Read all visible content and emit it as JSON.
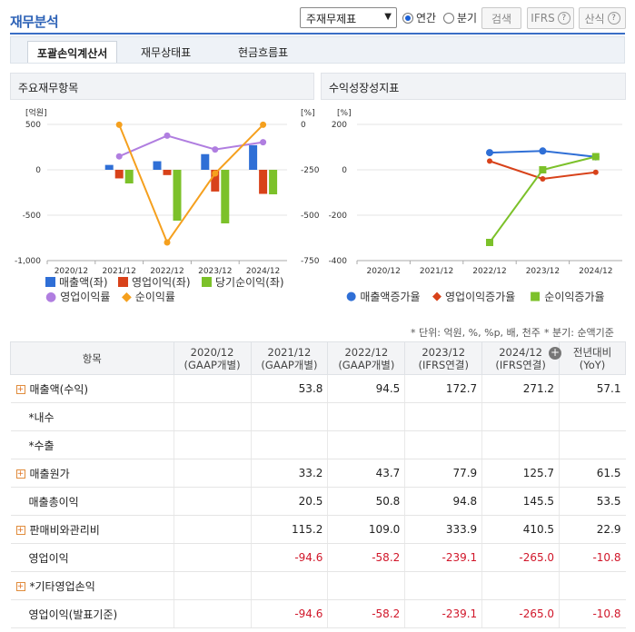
{
  "header": {
    "title": "재무분석",
    "select_value": "주재무제표",
    "radio_annual": "연간",
    "radio_quarter": "분기",
    "search_label": "검색",
    "ifrs_label": "IFRS",
    "formula_label": "산식"
  },
  "tabs": [
    "포괄손익계산서",
    "재무상태표",
    "현금흐름표"
  ],
  "panels": {
    "left_title": "주요재무항목",
    "right_title": "수익성장성지표"
  },
  "left_chart_axis": {
    "left_unit": "[억원]",
    "right_unit": "[%]",
    "left_ticks": [
      "500",
      "0",
      "-500",
      "-1,000"
    ],
    "right_ticks": [
      "0",
      "-250",
      "-500",
      "-750"
    ],
    "x_labels": [
      "2020/12",
      "2021/12",
      "2022/12",
      "2023/12",
      "2024/12"
    ]
  },
  "right_chart_axis": {
    "unit": "[%]",
    "ticks": [
      "200",
      "0",
      "-200",
      "-400"
    ],
    "x_labels": [
      "2020/12",
      "2021/12",
      "2022/12",
      "2023/12",
      "2024/12"
    ]
  },
  "chart_data": [
    {
      "type": "bar",
      "categories": [
        "2020/12",
        "2021/12",
        "2022/12",
        "2023/12",
        "2024/12"
      ],
      "series": [
        {
          "name": "매출액(좌)",
          "values": [
            null,
            53.8,
            94.5,
            172.7,
            271.2
          ],
          "color": "#2f6fd6"
        },
        {
          "name": "영업이익(좌)",
          "values": [
            null,
            -94.6,
            -58.2,
            -239.1,
            -265.0
          ],
          "color": "#d8421a"
        },
        {
          "name": "당기순이익(좌)",
          "values": [
            null,
            -150,
            -560,
            -590,
            -270
          ],
          "color": "#7cc12a"
        },
        {
          "name": "영업이익률",
          "values": [
            null,
            -176,
            -62,
            -138,
            -98
          ],
          "color": "#b07ee0"
        },
        {
          "name": "순이익률",
          "values": [
            null,
            -2,
            -650,
            -270,
            -2
          ],
          "color": "#f5a01e"
        }
      ],
      "ylim": [
        -1000,
        500
      ],
      "y2lim": [
        -750,
        0
      ]
    },
    {
      "type": "line",
      "categories": [
        "2020/12",
        "2021/12",
        "2022/12",
        "2023/12",
        "2024/12"
      ],
      "series": [
        {
          "name": "매출액증가율",
          "values": [
            null,
            null,
            75.7,
            82.8,
            57.1
          ],
          "color": "#2f6fd6"
        },
        {
          "name": "영업이익증가율",
          "values": [
            null,
            null,
            38.5,
            -40,
            -10.8
          ],
          "color": "#d8421a"
        },
        {
          "name": "순이익증가율",
          "values": [
            null,
            null,
            -320,
            0,
            58
          ],
          "color": "#7cc12a"
        }
      ],
      "ylim": [
        -400,
        200
      ]
    }
  ],
  "unit_note": "* 단위: 억원, %, %p, 배, 천주",
  "quarter_note": "* 분기: 순액기준",
  "table": {
    "headers": [
      "항목",
      "2020/12\n(GAAP개별)",
      "2021/12\n(GAAP개별)",
      "2022/12\n(GAAP개별)",
      "2023/12\n(IFRS연결)",
      "2024/12\n(IFRS연결)",
      "전년대비\n(YoY)"
    ],
    "rows": [
      {
        "name": "매출액(수익)",
        "plus": true,
        "vals": [
          "",
          "53.8",
          "94.5",
          "172.7",
          "271.2",
          "57.1"
        ]
      },
      {
        "name": "*내수",
        "plus": false,
        "vals": [
          "",
          "",
          "",
          "",
          "",
          ""
        ]
      },
      {
        "name": "*수출",
        "plus": false,
        "vals": [
          "",
          "",
          "",
          "",
          "",
          ""
        ]
      },
      {
        "name": "매출원가",
        "plus": true,
        "vals": [
          "",
          "33.2",
          "43.7",
          "77.9",
          "125.7",
          "61.5"
        ]
      },
      {
        "name": "매출총이익",
        "plus": false,
        "vals": [
          "",
          "20.5",
          "50.8",
          "94.8",
          "145.5",
          "53.5"
        ]
      },
      {
        "name": "판매비와관리비",
        "plus": true,
        "vals": [
          "",
          "115.2",
          "109.0",
          "333.9",
          "410.5",
          "22.9"
        ]
      },
      {
        "name": "영업이익",
        "plus": false,
        "vals": [
          "",
          "-94.6",
          "-58.2",
          "-239.1",
          "-265.0",
          "-10.8"
        ]
      },
      {
        "name": "*기타영업손익",
        "plus": true,
        "vals": [
          "",
          "",
          "",
          "",
          "",
          ""
        ]
      },
      {
        "name": "영업이익(발표기준)",
        "plus": false,
        "vals": [
          "",
          "-94.6",
          "-58.2",
          "-239.1",
          "-265.0",
          "-10.8"
        ]
      }
    ]
  }
}
